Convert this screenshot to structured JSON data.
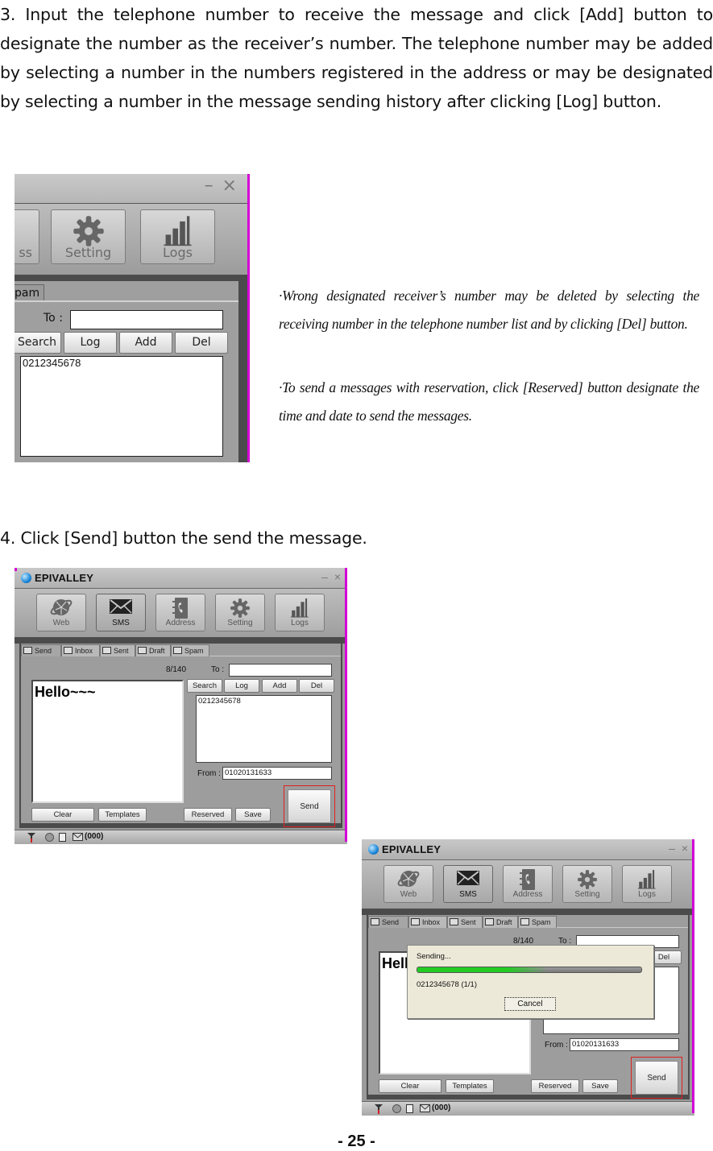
{
  "step3": {
    "text": "3. Input the telephone number to receive the message and click [Add] button to designate the number as the receiver’s number. The telephone number may be added by selecting a number in the numbers registered in the address or may be designated by selecting a number in the message sending history after clicking [Log] button."
  },
  "notes": [
    "·Wrong designated receiver’s number may be deleted by selecting the receiving number in the telephone number list and by clicking [Del] button.",
    "·To send a messages with reservation, click [Reserved] button designate the time and date to send the messages."
  ],
  "step4": {
    "text": "4. Click [Send] button the send the message."
  },
  "page_number": "- 25 -",
  "screenshot_crop": {
    "window_controls": "– ×",
    "toolbar": [
      {
        "label": "ss",
        "icon": "address-book-icon"
      },
      {
        "label": "Setting",
        "icon": "gear-icon"
      },
      {
        "label": "Logs",
        "icon": "bar-chart-icon"
      }
    ],
    "tab_partial": "pam",
    "to_label": "To :",
    "to_value": "",
    "buttons": [
      "Search",
      "Log",
      "Add",
      "Del"
    ],
    "recipients": [
      "0212345678"
    ]
  },
  "app": {
    "title": "EPIVALLEY",
    "window_controls": "– ×",
    "toolbar": [
      {
        "label": "Web",
        "icon": "globe-icon"
      },
      {
        "label": "SMS",
        "icon": "envelope-icon",
        "active": true
      },
      {
        "label": "Address",
        "icon": "address-book-icon"
      },
      {
        "label": "Setting",
        "icon": "gear-icon"
      },
      {
        "label": "Logs",
        "icon": "bar-chart-icon"
      }
    ],
    "tabs": [
      {
        "label": "Send",
        "active": true
      },
      {
        "label": "Inbox"
      },
      {
        "label": "Sent"
      },
      {
        "label": "Draft"
      },
      {
        "label": "Spam"
      }
    ],
    "char_counter": "8/140",
    "to_label": "To :",
    "to_value": "",
    "message": "Hello~~~",
    "recipient_buttons": [
      "Search",
      "Log",
      "Add",
      "Del"
    ],
    "recipients": [
      "0212345678"
    ],
    "from_label": "From :",
    "from_value": "01020131633",
    "bottom_buttons": {
      "clear": "Clear",
      "templates": "Templates",
      "reserved": "Reserved",
      "save": "Save",
      "send": "Send"
    },
    "status": {
      "message_count": "(000)"
    },
    "highlight_color": "#e02020"
  },
  "sending_dialog": {
    "title": "Sending...",
    "progress_percent": 40,
    "detail": "0212345678 (1/1)",
    "cancel_label": "Cancel",
    "progress_color": "#22cc22"
  }
}
